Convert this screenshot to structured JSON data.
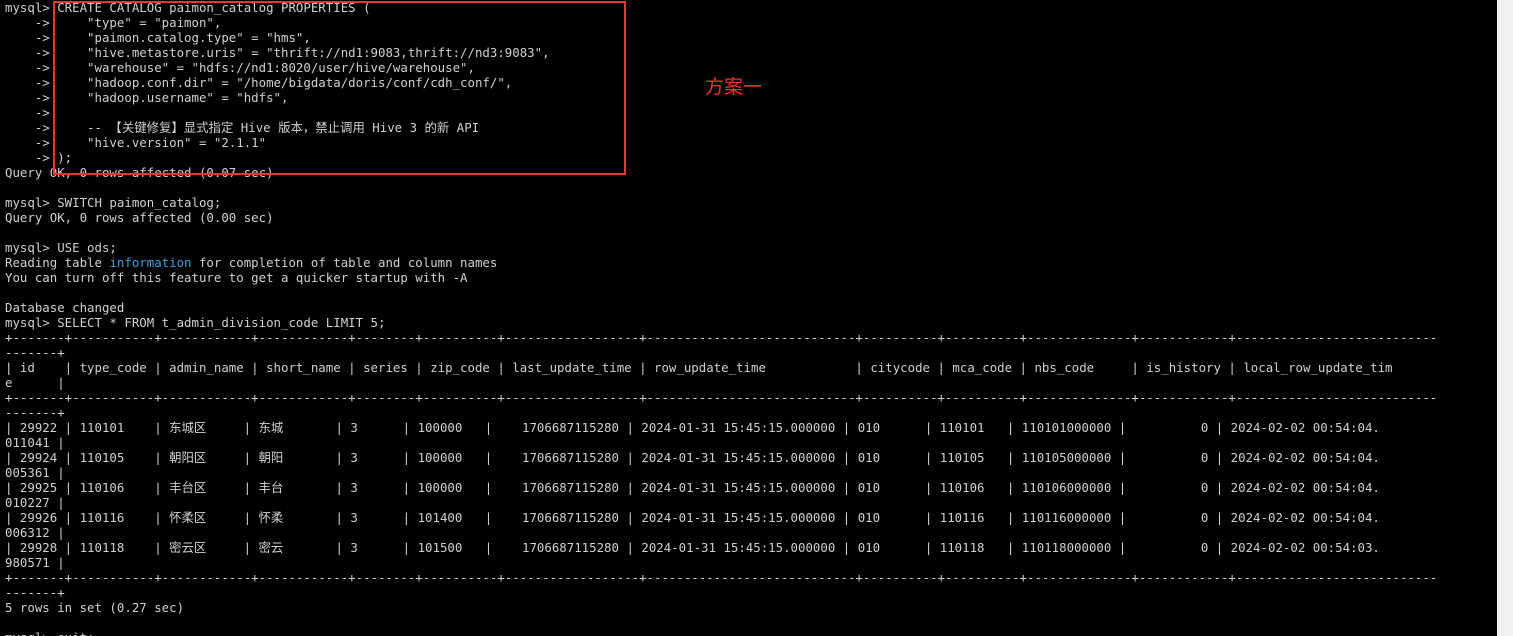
{
  "terminal": {
    "lines": [
      "mysql> CREATE CATALOG paimon_catalog PROPERTIES (",
      "    ->     \"type\" = \"paimon\",",
      "    ->     \"paimon.catalog.type\" = \"hms\",",
      "    ->     \"hive.metastore.uris\" = \"thrift://nd1:9083,thrift://nd3:9083\",",
      "    ->     \"warehouse\" = \"hdfs://nd1:8020/user/hive/warehouse\",",
      "    ->     \"hadoop.conf.dir\" = \"/home/bigdata/doris/conf/cdh_conf/\",",
      "    ->     \"hadoop.username\" = \"hdfs\",",
      "    ->",
      "    ->     -- 【关键修复】显式指定 Hive 版本，禁止调用 Hive 3 的新 API",
      "    ->     \"hive.version\" = \"2.1.1\"",
      "    -> );",
      "Query OK, 0 rows affected (0.07 sec)",
      "",
      "mysql> SWITCH paimon_catalog;",
      "Query OK, 0 rows affected (0.00 sec)",
      "",
      "mysql> USE ods;",
      "Reading table information for completion of table and column names",
      "You can turn off this feature to get a quicker startup with -A",
      "",
      "Database changed",
      "mysql> SELECT * FROM t_admin_division_code LIMIT 5;",
      "+-------+-----------+------------+------------+--------+----------+------------------+----------------------------+----------+----------+--------------+------------+---------------------------",
      "-------+",
      "| id    | type_code | admin_name | short_name | series | zip_code | last_update_time | row_update_time            | citycode | mca_code | nbs_code     | is_history | local_row_update_tim",
      "e      |",
      "+-------+-----------+------------+------------+--------+----------+------------------+----------------------------+----------+----------+--------------+------------+---------------------------",
      "-------+",
      "| 29922 | 110101    | 东城区     | 东城       | 3      | 100000   |    1706687115280 | 2024-01-31 15:45:15.000000 | 010      | 110101   | 110101000000 |          0 | 2024-02-02 00:54:04.",
      "011041 |",
      "| 29924 | 110105    | 朝阳区     | 朝阳       | 3      | 100000   |    1706687115280 | 2024-01-31 15:45:15.000000 | 010      | 110105   | 110105000000 |          0 | 2024-02-02 00:54:04.",
      "005361 |",
      "| 29925 | 110106    | 丰台区     | 丰台       | 3      | 100000   |    1706687115280 | 2024-01-31 15:45:15.000000 | 010      | 110106   | 110106000000 |          0 | 2024-02-02 00:54:04.",
      "010227 |",
      "| 29926 | 110116    | 怀柔区     | 怀柔       | 3      | 101400   |    1706687115280 | 2024-01-31 15:45:15.000000 | 010      | 110116   | 110116000000 |          0 | 2024-02-02 00:54:04.",
      "006312 |",
      "| 29928 | 110118    | 密云区     | 密云       | 3      | 101500   |    1706687115280 | 2024-01-31 15:45:15.000000 | 010      | 110118   | 110118000000 |          0 | 2024-02-02 00:54:03.",
      "980571 |",
      "+-------+-----------+------------+------------+--------+----------+------------------+----------------------------+----------+----------+--------------+------------+---------------------------",
      "-------+",
      "5 rows in set (0.27 sec)",
      "",
      "mysql> exit;"
    ],
    "highlighted_word": "information"
  },
  "annotation": {
    "label": "方案一",
    "color": "#e8352e"
  },
  "colors": {
    "background": "#000000",
    "text": "#d0d0d0",
    "keyword_highlight": "#3aa0e0",
    "annotation_red": "#e8352e"
  }
}
